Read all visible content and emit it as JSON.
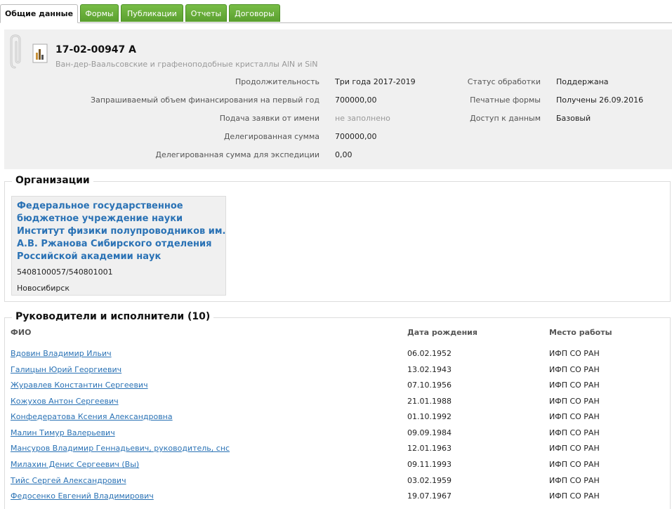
{
  "tabs": [
    {
      "label": "Общие данные",
      "active": true
    },
    {
      "label": "Формы",
      "active": false
    },
    {
      "label": "Публикации",
      "active": false
    },
    {
      "label": "Отчеты",
      "active": false
    },
    {
      "label": "Договоры",
      "active": false
    }
  ],
  "project": {
    "number": "17-02-00947 А",
    "title": "Ван-дер-Ваальсовские и графеноподобные кристаллы AlN и SiN",
    "fields_left": [
      {
        "label": "Продолжительность",
        "value": "Три года 2017-2019",
        "muted": false
      },
      {
        "label": "Запрашиваемый объем финансирования на первый год",
        "value": "700000,00",
        "muted": false
      },
      {
        "label": "Подача заявки от имени",
        "value": "не заполнено",
        "muted": true
      },
      {
        "label": "Делегированная сумма",
        "value": "700000,00",
        "muted": false
      },
      {
        "label": "Делегированная сумма для экспедиции",
        "value": "0,00",
        "muted": false
      }
    ],
    "fields_right": [
      {
        "label": "Статус обработки",
        "value": "Поддержана"
      },
      {
        "label": "Печатные формы",
        "value": "Получены 26.09.2016"
      },
      {
        "label": "Доступ к данным",
        "value": "Базовый"
      }
    ]
  },
  "organizations": {
    "title": "Организации",
    "items": [
      {
        "name": "Федеральное государственное бюджетное учреждение науки Институт физики полупроводников им. А.В. Ржанова Сибирского отделения Российской академии наук",
        "inn": "5408100057/540801001",
        "city": "Новосибирск"
      }
    ]
  },
  "people": {
    "title": "Руководители и исполнители (10)",
    "columns": [
      "ФИО",
      "Дата рождения",
      "Место работы"
    ],
    "rows": [
      {
        "name": "Вдовин Владимир Ильич",
        "birth": "06.02.1952",
        "work": "ИФП СО РАН"
      },
      {
        "name": "Галицын Юрий Георгиевич",
        "birth": "13.02.1943",
        "work": "ИФП СО РАН"
      },
      {
        "name": "Журавлев Константин Сергеевич",
        "birth": "07.10.1956",
        "work": "ИФП СО РАН"
      },
      {
        "name": "Кожухов Антон Сергеевич",
        "birth": "21.01.1988",
        "work": "ИФП СО РАН"
      },
      {
        "name": "Конфедератова Ксения Александровна",
        "birth": "01.10.1992",
        "work": "ИФП СО РАН"
      },
      {
        "name": "Малин Тимур Валерьевич",
        "birth": "09.09.1984",
        "work": "ИФП СО РАН"
      },
      {
        "name": "Мансуров Владимир Геннадьевич, руководитель, снс",
        "birth": "12.01.1963",
        "work": "ИФП СО РАН"
      },
      {
        "name": "Милахин Денис Сергеевич (Вы)",
        "birth": "09.11.1993",
        "work": "ИФП СО РАН"
      },
      {
        "name": "Тийс Сергей Александрович",
        "birth": "03.02.1959",
        "work": "ИФП СО РАН"
      },
      {
        "name": "Федосенко Евгений Владимирович",
        "birth": "19.07.1967",
        "work": "ИФП СО РАН"
      }
    ]
  }
}
